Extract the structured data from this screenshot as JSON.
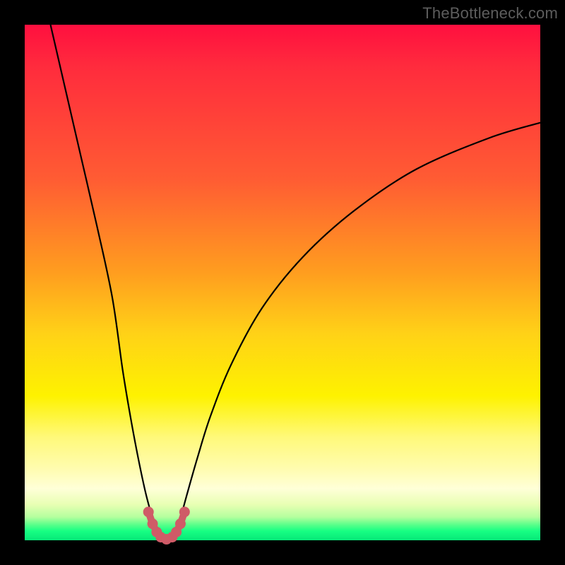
{
  "watermark": "TheBottleneck.com",
  "chart_data": {
    "type": "line",
    "title": "",
    "xlabel": "",
    "ylabel": "",
    "xlim": [
      0,
      100
    ],
    "ylim": [
      0,
      100
    ],
    "grid": false,
    "legend": false,
    "series": [
      {
        "name": "left-branch",
        "x": [
          5,
          8,
          11,
          14,
          17,
          19,
          20.5,
          22,
          23.5,
          25,
          25.8
        ],
        "y": [
          100,
          87,
          74,
          61,
          47,
          33,
          24,
          16,
          9,
          3.5,
          1
        ]
      },
      {
        "name": "right-branch",
        "x": [
          29.2,
          30,
          31.5,
          33.5,
          36,
          40,
          46,
          54,
          64,
          76,
          90,
          100
        ],
        "y": [
          1,
          3.5,
          9,
          16,
          24,
          34,
          45,
          55,
          64,
          72,
          78,
          81
        ]
      },
      {
        "name": "valley-floor",
        "x": [
          25.8,
          26.6,
          27.5,
          28.4,
          29.2
        ],
        "y": [
          1,
          0.3,
          0.1,
          0.3,
          1
        ]
      }
    ],
    "markers": {
      "name": "valley-beads",
      "color": "#cf5b67",
      "x": [
        24.0,
        24.8,
        25.6,
        26.4,
        27.5,
        28.6,
        29.4,
        30.2,
        31.0
      ],
      "y": [
        5.5,
        3.2,
        1.6,
        0.6,
        0.2,
        0.6,
        1.6,
        3.2,
        5.5
      ]
    },
    "gradient_stops": [
      {
        "pos": 0.0,
        "color": "#ff0f3f"
      },
      {
        "pos": 0.3,
        "color": "#ff5c33"
      },
      {
        "pos": 0.6,
        "color": "#ffd217"
      },
      {
        "pos": 0.8,
        "color": "#fff97a"
      },
      {
        "pos": 0.95,
        "color": "#b4ff9e"
      },
      {
        "pos": 1.0,
        "color": "#06e878"
      }
    ]
  }
}
